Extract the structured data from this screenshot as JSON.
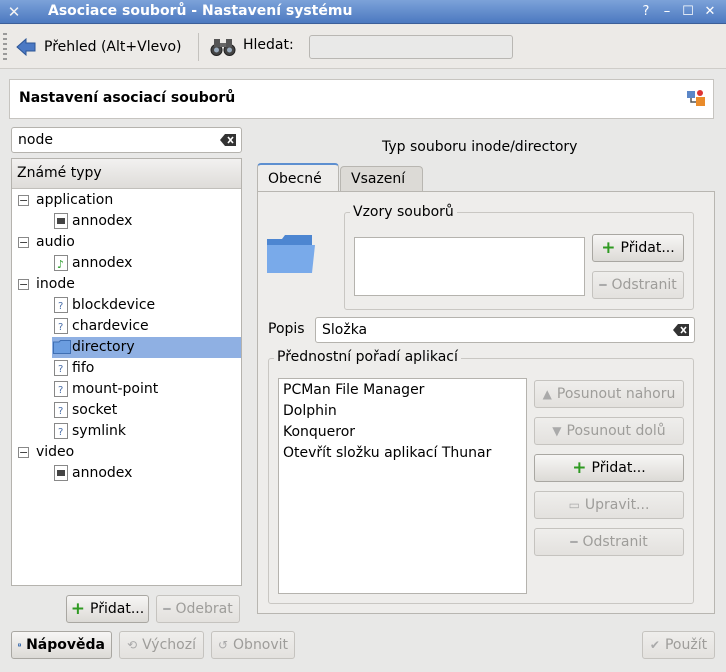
{
  "window": {
    "title": "Asociace souborů - Nastavení systému",
    "buttons": [
      "help",
      "minimize",
      "maximize",
      "close"
    ]
  },
  "toolbar": {
    "back_label": "Přehled (Alt+Vlevo)",
    "search_label": "Hledat:",
    "search_value": ""
  },
  "header": {
    "title": "Nastavení asociací souborů"
  },
  "filter": {
    "value": "node"
  },
  "tree": {
    "header": "Známé typy",
    "groups": [
      {
        "label": "application",
        "children": [
          "annodex"
        ]
      },
      {
        "label": "audio",
        "children": [
          "annodex"
        ]
      },
      {
        "label": "inode",
        "children": [
          "blockdevice",
          "chardevice",
          "directory",
          "fifo",
          "mount-point",
          "socket",
          "symlink"
        ]
      },
      {
        "label": "video",
        "children": [
          "annodex"
        ]
      }
    ],
    "selected": "directory"
  },
  "tree_buttons": {
    "add": "Přidat...",
    "remove": "Odebrat"
  },
  "details": {
    "type_title": "Typ souboru inode/directory",
    "tabs": [
      "Obecné",
      "Vsazení"
    ],
    "active_tab": "Obecné",
    "patterns_group": "Vzory souborů",
    "patterns": [],
    "patterns_add": "Přidat...",
    "patterns_remove": "Odstranit",
    "description_label": "Popis",
    "description_value": "Složka",
    "apps_group": "Přednostní pořadí aplikací",
    "apps": [
      "PCMan File Manager",
      "Dolphin",
      "Konqueror",
      "Otevřít složku aplikací Thunar"
    ],
    "app_buttons": {
      "move_up": "Posunout nahoru",
      "move_down": "Posunout dolů",
      "add": "Přidat...",
      "edit": "Upravit...",
      "remove": "Odstranit"
    }
  },
  "footer": {
    "help": "Nápověda",
    "defaults": "Výchozí",
    "reset": "Obnovit",
    "apply": "Použít"
  },
  "colors": {
    "titlebar": "#4c79c0",
    "selection": "#8fb0e3",
    "add_icon": "#2f9a22"
  }
}
